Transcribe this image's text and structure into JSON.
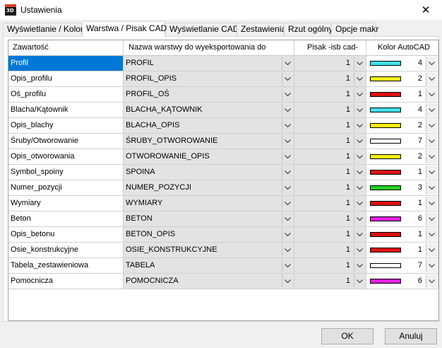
{
  "window": {
    "title": "Ustawienia",
    "icon_text": "3D",
    "close": "✕"
  },
  "tabs": [
    {
      "label": "Wyświetlanie / Kolory",
      "active": false
    },
    {
      "label": "Warstwa / Pisak CAD",
      "active": true
    },
    {
      "label": "Wyświetlanie CAD",
      "active": false
    },
    {
      "label": "Zestawienia",
      "active": false
    },
    {
      "label": "Rzut ogólny",
      "active": false
    },
    {
      "label": "Opcje makr",
      "active": false
    }
  ],
  "grid": {
    "headers": [
      "Zawartość",
      "Nazwa warstwy do wyeksportowania do",
      "Pisak -isb cad-",
      "Kolor AutoCAD"
    ],
    "rows": [
      {
        "content": "Profil",
        "layer": "PROFIL",
        "pen": "1",
        "color_index": "4",
        "swatch": "#3fe0e8",
        "selected": true
      },
      {
        "content": "Opis_profilu",
        "layer": "PROFIL_OPIS",
        "pen": "1",
        "color_index": "2",
        "swatch": "#f5f010"
      },
      {
        "content": "Oś_profilu",
        "layer": "PROFIL_OŚ",
        "pen": "1",
        "color_index": "1",
        "swatch": "#e01010"
      },
      {
        "content": "Blacha/Kątownik",
        "layer": "BLACHA_KĄTOWNIK",
        "pen": "1",
        "color_index": "4",
        "swatch": "#3fe0e8"
      },
      {
        "content": "Opis_blachy",
        "layer": "BLACHA_OPIS",
        "pen": "1",
        "color_index": "2",
        "swatch": "#f5f010"
      },
      {
        "content": "Śruby/Otworowanie",
        "layer": "ŚRUBY_OTWOROWANIE",
        "pen": "1",
        "color_index": "7",
        "swatch": "#ffffff"
      },
      {
        "content": "Opis_otworowania",
        "layer": "OTWOROWANIE_OPIS",
        "pen": "1",
        "color_index": "2",
        "swatch": "#f5f010"
      },
      {
        "content": "Symbol_spoiny",
        "layer": "SPOINA",
        "pen": "1",
        "color_index": "1",
        "swatch": "#e01010"
      },
      {
        "content": "Numer_pozycji",
        "layer": "NUMER_POZYCJI",
        "pen": "1",
        "color_index": "3",
        "swatch": "#20d020"
      },
      {
        "content": "Wymiary",
        "layer": "WYMIARY",
        "pen": "1",
        "color_index": "1",
        "swatch": "#e01010"
      },
      {
        "content": "Beton",
        "layer": "BETON",
        "pen": "1",
        "color_index": "6",
        "swatch": "#e020e0"
      },
      {
        "content": "Opis_betonu",
        "layer": "BETON_OPIS",
        "pen": "1",
        "color_index": "1",
        "swatch": "#e01010"
      },
      {
        "content": "Osie_konstrukcyjne",
        "layer": "OSIE_KONSTRUKCYJNE",
        "pen": "1",
        "color_index": "1",
        "swatch": "#e01010"
      },
      {
        "content": "Tabela_zestawieniowa",
        "layer": "TABELA",
        "pen": "1",
        "color_index": "7",
        "swatch": "#ffffff"
      },
      {
        "content": "Pomocnicza",
        "layer": "POMOCNICZA",
        "pen": "1",
        "color_index": "6",
        "swatch": "#e020e0"
      }
    ]
  },
  "buttons": {
    "ok": "OK",
    "cancel": "Anuluj"
  },
  "colors": {
    "selection": "#0078d7",
    "combo_bg": "#e3e3e3"
  }
}
